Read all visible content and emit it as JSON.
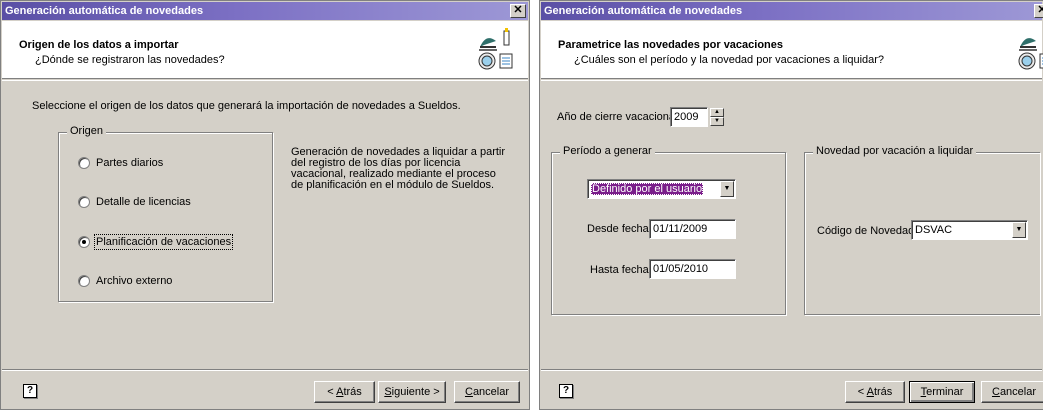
{
  "dialog1": {
    "title": "Generación automática de novedades",
    "close": "✕",
    "header_title": "Origen de los datos a importar",
    "header_subtitle": "¿Dónde se registraron las novedades?",
    "intro": "Seleccione el origen de los datos que generará la importación de novedades a Sueldos.",
    "group_label": "Origen",
    "options": [
      {
        "label": "Partes diarios",
        "checked": false
      },
      {
        "label": "Detalle de licencias",
        "checked": false
      },
      {
        "label": "Planificación de vacaciones",
        "checked": true
      },
      {
        "label": "Archivo externo",
        "checked": false
      }
    ],
    "description": "Generación de novedades a liquidar a partir del registro de los días por licencia vacacional, realizado mediante el proceso de planificación en el módulo de Sueldos.",
    "help": "?",
    "buttons": {
      "back": {
        "pre": "< ",
        "key": "A",
        "post": "trás"
      },
      "next": {
        "key": "S",
        "post": "iguiente >"
      },
      "cancel": {
        "key": "C",
        "post": "ancelar"
      }
    }
  },
  "dialog2": {
    "title": "Generación automática de novedades",
    "close": "✕",
    "header_title": "Parametrice las novedades por vacaciones",
    "header_subtitle": "¿Cuáles son el período y la novedad por vacaciones a liquidar?",
    "year_label": "Año de cierre vacacional:",
    "year_value": "2009",
    "period_group_label": "Período a generar",
    "period_select": "Definido por el usuario",
    "from_label": "Desde fecha:",
    "from_value": "01/11/2009",
    "to_label": "Hasta fecha:",
    "to_value": "01/05/2010",
    "novelty_group_label": "Novedad por vacación a liquidar",
    "code_label": "Código de Novedad:",
    "code_value": "DSVAC",
    "help": "?",
    "buttons": {
      "back": {
        "pre": "< ",
        "key": "A",
        "post": "trás"
      },
      "finish": {
        "key": "T",
        "post": "erminar"
      },
      "cancel": {
        "key": "C",
        "post": "ancelar"
      }
    }
  },
  "icons": {
    "wizard": "wizard-header-icon",
    "spin_up": "▲",
    "spin_down": "▼",
    "dropdown": "▼"
  }
}
